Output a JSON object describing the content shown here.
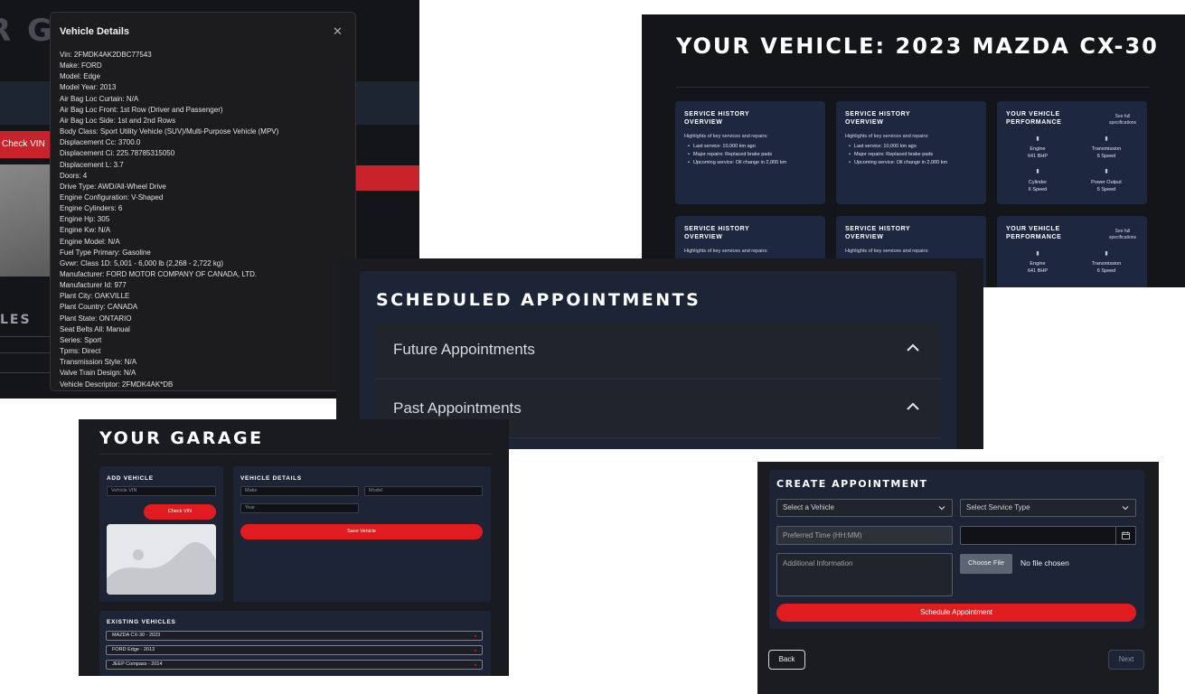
{
  "garage_background": {
    "title_fragment": "R GA",
    "check_vin_label": "Check VIN",
    "section_fragment": "LES"
  },
  "vehicle_details_modal": {
    "title": "Vehicle Details",
    "close_icon": "close-icon",
    "specs": [
      "Vin: 2FMDK4AK2DBC77543",
      "Make: FORD",
      "Model: Edge",
      "Model Year: 2013",
      "Air Bag Loc Curtain: N/A",
      "Air Bag Loc Front: 1st Row (Driver and Passenger)",
      "Air Bag Loc Side: 1st and 2nd Rows",
      "Body Class: Sport Utility Vehicle (SUV)/Multi-Purpose Vehicle (MPV)",
      "Displacement Cc: 3700.0",
      "Displacement Ci: 225.78785315050",
      "Displacement L: 3.7",
      "Doors: 4",
      "Drive Type: AWD/All-Wheel Drive",
      "Engine Configuration: V-Shaped",
      "Engine Cylinders: 6",
      "Engine Hp: 305",
      "Engine Kw: N/A",
      "Engine Model: N/A",
      "Fuel Type Primary: Gasoline",
      "Gvwr: Class 1D: 5,001 - 6,000 lb (2,268 - 2,722 kg)",
      "Manufacturer: FORD MOTOR COMPANY OF CANADA, LTD.",
      "Manufacturer Id: 977",
      "Plant City: OAKVILLE",
      "Plant Country: CANADA",
      "Plant State: ONTARIO",
      "Seat Belts All: Manual",
      "Series: Sport",
      "Tpms: Direct",
      "Transmission Style: N/A",
      "Valve Train Design: N/A",
      "Vehicle Descriptor: 2FMDK4AK*DB"
    ]
  },
  "your_vehicle": {
    "title": "YOUR VEHICLE: 2023 MAZDA CX-30",
    "service_card": {
      "title": "SERVICE HISTORY OVERVIEW",
      "subtitle": "Highlights of key services and repairs:",
      "items": [
        "Last service: 10,000 km ago",
        "Major repairs: Replaced brake pads",
        "Upcoming service: Oil change in 2,000 km"
      ]
    },
    "performance_card": {
      "title": "YOUR VEHICLE PERFORMANCE",
      "link": "See full specifications",
      "stats": [
        {
          "label": "Engine",
          "value": "641 BHP",
          "icon": "engine-icon"
        },
        {
          "label": "Transmission",
          "value": "6 Speed",
          "icon": "transmission-icon"
        },
        {
          "label": "Cylinder",
          "value": "6 Speed",
          "icon": "cylinder-icon"
        },
        {
          "label": "Power Output",
          "value": "6 Speed",
          "icon": "power-icon"
        }
      ]
    }
  },
  "scheduled": {
    "title": "SCHEDULED APPOINTMENTS",
    "sections": [
      {
        "label": "Future Appointments",
        "icon": "chevron-up-icon"
      },
      {
        "label": "Past Appointments",
        "icon": "chevron-up-icon"
      }
    ]
  },
  "garage": {
    "title": "YOUR GARAGE",
    "add_vehicle": {
      "heading": "ADD VEHICLE",
      "vin_placeholder": "Vehicle VIN",
      "check_button": "Check VIN",
      "image_icon": "image-placeholder-icon"
    },
    "vehicle_details": {
      "heading": "VEHICLE DETAILS",
      "make_placeholder": "Make",
      "model_placeholder": "Model",
      "year_placeholder": "Year",
      "save_button": "Save Vehicle"
    },
    "existing": {
      "heading": "EXISTING VEHICLES",
      "vehicles": [
        "MAZDA CX-30 - 2023",
        "FORD Edge - 2013",
        "JEEP Compass - 2014"
      ]
    }
  },
  "create_appointment": {
    "title": "CREATE APPOINTMENT",
    "vehicle_select": "Select a Vehicle",
    "service_select": "Select Service Type",
    "time_placeholder": "Preferred Time (HH:MM)",
    "calendar_icon": "calendar-icon",
    "info_placeholder": "Additional Information",
    "choose_file": "Choose File",
    "no_file": "No file chosen",
    "schedule_button": "Schedule Appointment",
    "back_button": "Back",
    "next_button": "Next"
  },
  "colors": {
    "accent_red": "#e01c20",
    "card_navy": "#1d2740",
    "dark_bg": "#141518"
  }
}
